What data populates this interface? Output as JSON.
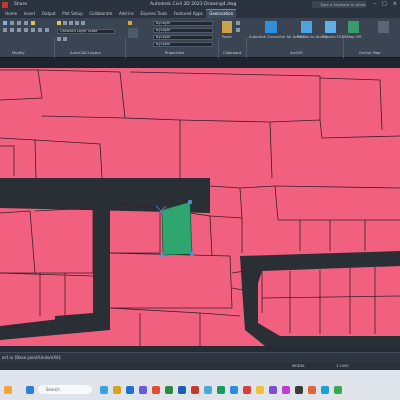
{
  "titlebar": {
    "share": "Share",
    "title": "Autodesk Civil 3D 2023   Drawing4.dwg",
    "search": "Type a keyword or phrase"
  },
  "tabs": [
    "Home",
    "Insert",
    "Output",
    "Plot Setup",
    "Collaborate",
    "Add-ins",
    "Express Tools",
    "Featured Apps",
    "Geolocation"
  ],
  "ribbon": {
    "layer_state": "Unsaved Layer State",
    "bylayer": "ByLayer",
    "bylayer2": "ByLayer",
    "bylayer3": "ByLayer",
    "bylayer4": "ByLayer",
    "paste": "Paste",
    "autodesk_connector": "Autodesk Connector for ArcGIS",
    "publish": "Publish to ArcGIS",
    "exports": "Exports FGDB",
    "map_on": "Map Off",
    "panels": {
      "modify": "Modify",
      "layers": "AutoCAD Layers",
      "properties": "Properties",
      "clipboard": "Clipboard",
      "arcgis": "ArcGIS",
      "online_map": "Online Map"
    }
  },
  "command": {
    "text": "ect or [Base point/Undo/eXit]:"
  },
  "status": {
    "model": "MODEL",
    "scale": "1:1000"
  },
  "taskbar": {
    "search": "Search"
  },
  "clock": {
    "time": "",
    "date": ""
  }
}
